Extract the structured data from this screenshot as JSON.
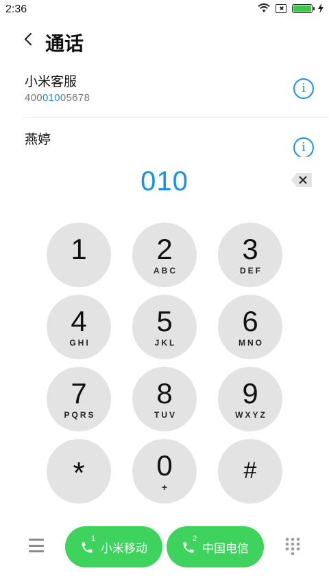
{
  "status": {
    "time": "2:36",
    "wifi_icon": "wifi-icon",
    "sim_icon": "no-sim-icon",
    "battery_icon": "battery-charging-icon",
    "battery_color": "#3dc84b"
  },
  "header": {
    "back_icon": "chevron-left-icon",
    "title": "通话"
  },
  "contacts": [
    {
      "name": "小米客服",
      "number_prefix": "400",
      "number_match": "010",
      "number_suffix": "05678",
      "info_icon": "info-icon"
    },
    {
      "name": "燕婷",
      "info_icon": "info-icon"
    }
  ],
  "dialer": {
    "number": "010",
    "backspace_icon": "backspace-icon",
    "accent_color": "#1b8ff0"
  },
  "keypad": {
    "keys": [
      {
        "digit": "1",
        "letters": ""
      },
      {
        "digit": "2",
        "letters": "ABC"
      },
      {
        "digit": "3",
        "letters": "DEF"
      },
      {
        "digit": "4",
        "letters": "GHI"
      },
      {
        "digit": "5",
        "letters": "JKL"
      },
      {
        "digit": "6",
        "letters": "MNO"
      },
      {
        "digit": "7",
        "letters": "PQRS"
      },
      {
        "digit": "8",
        "letters": "TUV"
      },
      {
        "digit": "9",
        "letters": "WXYZ"
      },
      {
        "digit": "*",
        "letters": ""
      },
      {
        "digit": "0",
        "letters": "+"
      },
      {
        "digit": "#",
        "letters": ""
      }
    ]
  },
  "bottom": {
    "menu_icon": "menu-icon",
    "call_buttons": [
      {
        "sim": "1",
        "label": "小米移动",
        "icon": "phone-icon"
      },
      {
        "sim": "2",
        "label": "中国电信",
        "icon": "phone-icon"
      }
    ],
    "keypad_toggle_icon": "dialpad-icon",
    "call_color": "#3ed35d"
  }
}
